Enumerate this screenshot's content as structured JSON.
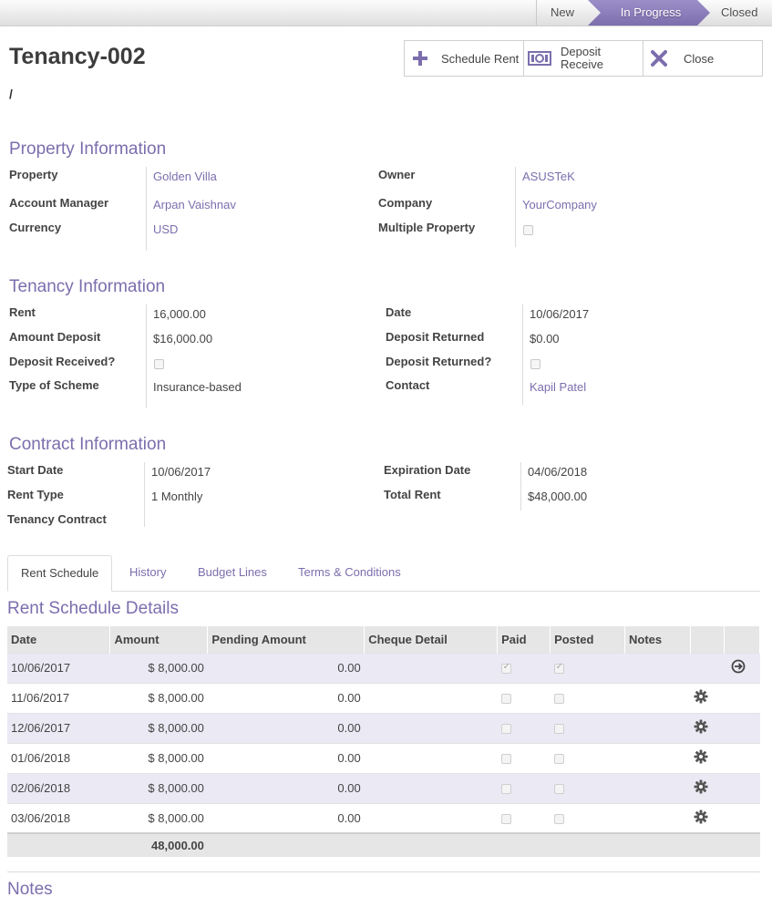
{
  "statusbar": {
    "stages": [
      "New",
      "In Progress",
      "Closed"
    ],
    "active": "In Progress"
  },
  "title": "Tenancy-002",
  "slash": "/",
  "buttons": {
    "schedule_rent": "Schedule Rent",
    "deposit_receive_1": "Deposit",
    "deposit_receive_2": "Receive",
    "close": "Close"
  },
  "property": {
    "heading": "Property Information",
    "property_label": "Property",
    "property_value": "Golden Villa",
    "account_manager_label": "Account Manager",
    "account_manager_value": "Arpan Vaishnav",
    "currency_label": "Currency",
    "currency_value": "USD",
    "owner_label": "Owner",
    "owner_value": "ASUSTeK",
    "company_label": "Company",
    "company_value": "YourCompany",
    "multiple_property_label": "Multiple Property"
  },
  "tenancy": {
    "heading": "Tenancy Information",
    "rent_label": "Rent",
    "rent_value": "16,000.00",
    "amount_deposit_label": "Amount Deposit",
    "amount_deposit_value": "$16,000.00",
    "deposit_received_label": "Deposit Received?",
    "type_of_scheme_label": "Type of Scheme",
    "type_of_scheme_value": "Insurance-based",
    "date_label": "Date",
    "date_value": "10/06/2017",
    "deposit_returned_label": "Deposit Returned",
    "deposit_returned_value": "$0.00",
    "deposit_returned_q_label": "Deposit Returned?",
    "contact_label": "Contact",
    "contact_value": "Kapil Patel"
  },
  "contract": {
    "heading": "Contract Information",
    "start_date_label": "Start Date",
    "start_date_value": "10/06/2017",
    "rent_type_label": "Rent Type",
    "rent_type_value": "1 Monthly",
    "tenancy_contract_label": "Tenancy Contract",
    "expiration_date_label": "Expiration Date",
    "expiration_date_value": "04/06/2018",
    "total_rent_label": "Total Rent",
    "total_rent_value": "$48,000.00"
  },
  "tabs": [
    "Rent Schedule",
    "History",
    "Budget Lines",
    "Terms & Conditions"
  ],
  "schedule": {
    "heading": "Rent Schedule Details",
    "columns": [
      "Date",
      "Amount",
      "Pending Amount",
      "Cheque Detail",
      "Paid",
      "Posted",
      "Notes"
    ],
    "rows": [
      {
        "date": "10/06/2017",
        "amount": "$ 8,000.00",
        "pending": "0.00",
        "paid": true,
        "posted": true,
        "action": "arrow-circle-icon"
      },
      {
        "date": "11/06/2017",
        "amount": "$ 8,000.00",
        "pending": "0.00",
        "paid": false,
        "posted": false,
        "action": "gear-icon"
      },
      {
        "date": "12/06/2017",
        "amount": "$ 8,000.00",
        "pending": "0.00",
        "paid": false,
        "posted": false,
        "action": "gear-icon"
      },
      {
        "date": "01/06/2018",
        "amount": "$ 8,000.00",
        "pending": "0.00",
        "paid": false,
        "posted": false,
        "action": "gear-icon"
      },
      {
        "date": "02/06/2018",
        "amount": "$ 8,000.00",
        "pending": "0.00",
        "paid": false,
        "posted": false,
        "action": "gear-icon"
      },
      {
        "date": "03/06/2018",
        "amount": "$ 8,000.00",
        "pending": "0.00",
        "paid": false,
        "posted": false,
        "action": "gear-icon"
      }
    ],
    "total": "48,000.00"
  },
  "notes_heading": "Notes",
  "colors": {
    "accent": "#7c6ead",
    "row_alt": "#ebe9f4"
  }
}
